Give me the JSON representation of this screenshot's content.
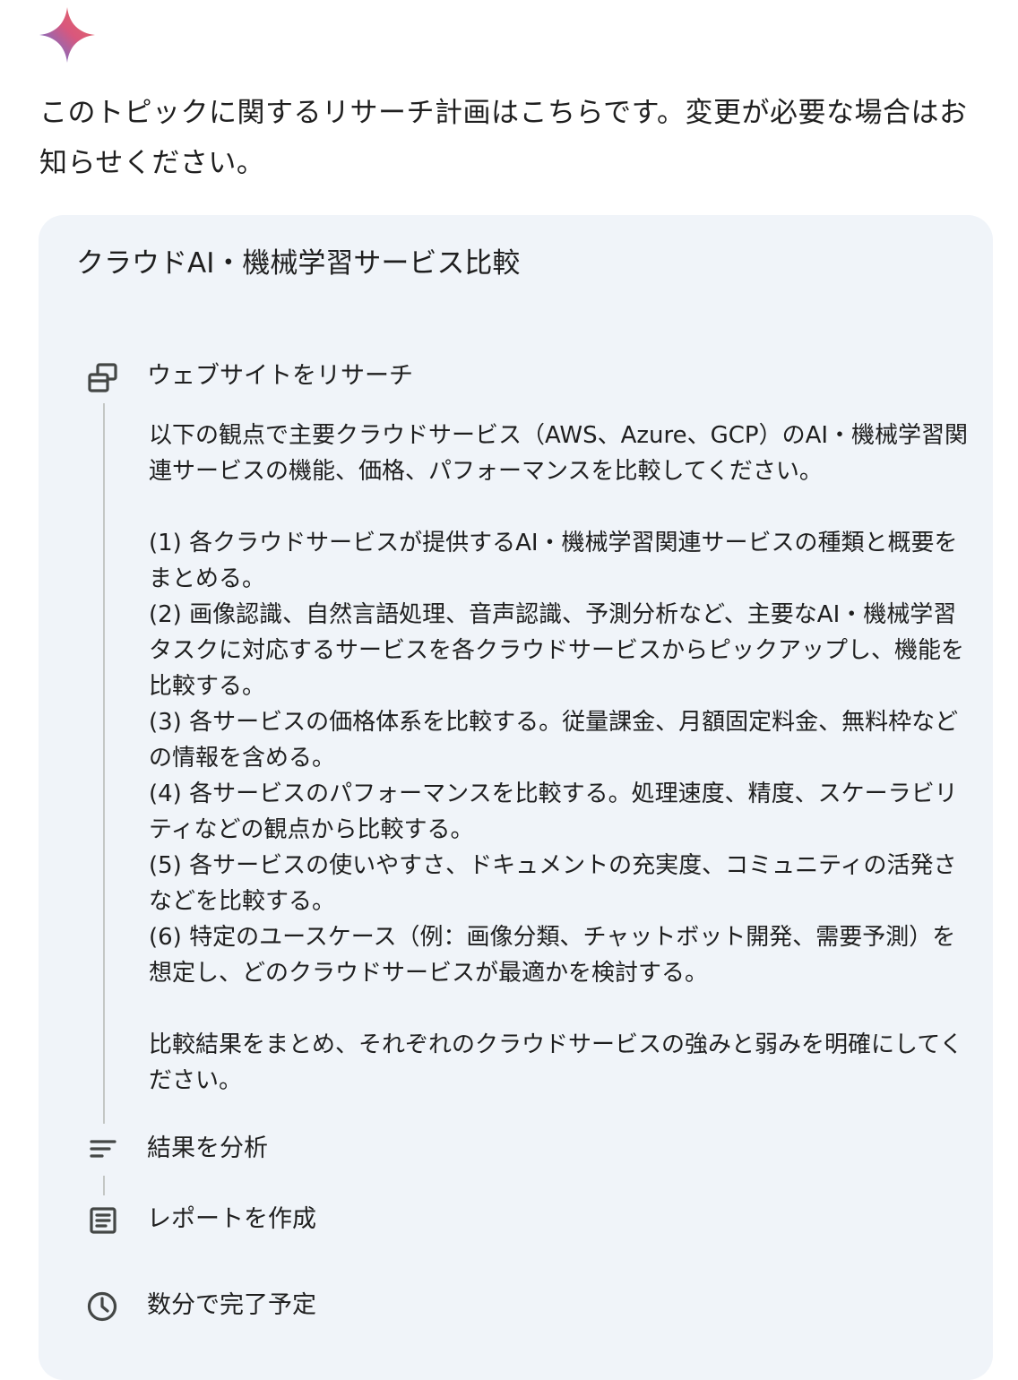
{
  "logo": {
    "icon": "gemini-sparkle-icon"
  },
  "intro": "このトピックに関するリサーチ計画はこちらです。変更が必要な場合はお知らせください。",
  "plan": {
    "title": "クラウドAI・機械学習サービス比較",
    "steps": [
      {
        "icon": "browse-web-icon",
        "label": "ウェブサイトをリサーチ",
        "body": "以下の観点で主要クラウドサービス（AWS、Azure、GCP）のAI・機械学習関連サービスの機能、価格、パフォーマンスを比較してください。\n\n(1) 各クラウドサービスが提供するAI・機械学習関連サービスの種類と概要をまとめる。\n(2) 画像認識、自然言語処理、音声認識、予測分析など、主要なAI・機械学習タスクに対応するサービスを各クラウドサービスからピックアップし、機能を比較する。\n(3) 各サービスの価格体系を比較する。従量課金、月額固定料金、無料枠などの情報を含める。\n(4) 各サービスのパフォーマンスを比較する。処理速度、精度、スケーラビリティなどの観点から比較する。\n(5) 各サービスの使いやすさ、ドキュメントの充実度、コミュニティの活発さなどを比較する。\n(6) 特定のユースケース（例：画像分類、チャットボット開発、需要予測）を想定し、どのクラウドサービスが最適かを検討する。\n\n比較結果をまとめ、それぞれのクラウドサービスの強みと弱みを明確にしてください。"
      },
      {
        "icon": "analyze-results-icon",
        "label": "結果を分析"
      },
      {
        "icon": "report-document-icon",
        "label": "レポートを作成"
      }
    ],
    "eta": {
      "icon": "clock-icon",
      "label": "数分で完了予定"
    }
  },
  "colors": {
    "card_background": "#f0f4f9",
    "text": "#1f1f1f",
    "icon": "#444746",
    "timeline": "#c4c7c5",
    "sparkle_gradient": [
      "#4f79e8",
      "#d9577d",
      "#e46a5f"
    ]
  }
}
